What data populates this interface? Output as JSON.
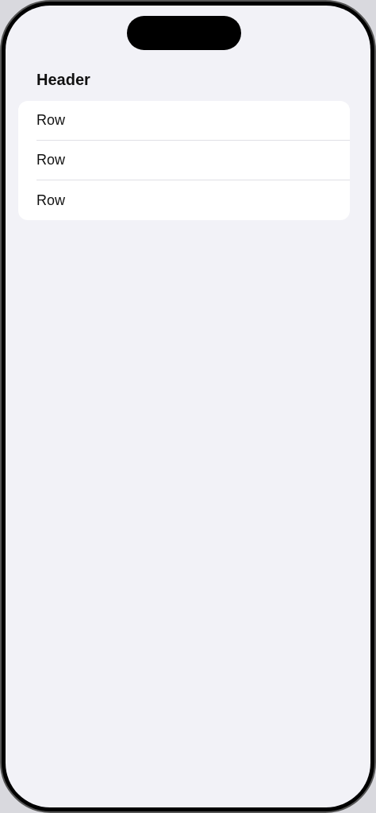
{
  "list": {
    "header": "Header",
    "rows": [
      {
        "label": "Row"
      },
      {
        "label": "Row"
      },
      {
        "label": "Row"
      }
    ]
  }
}
